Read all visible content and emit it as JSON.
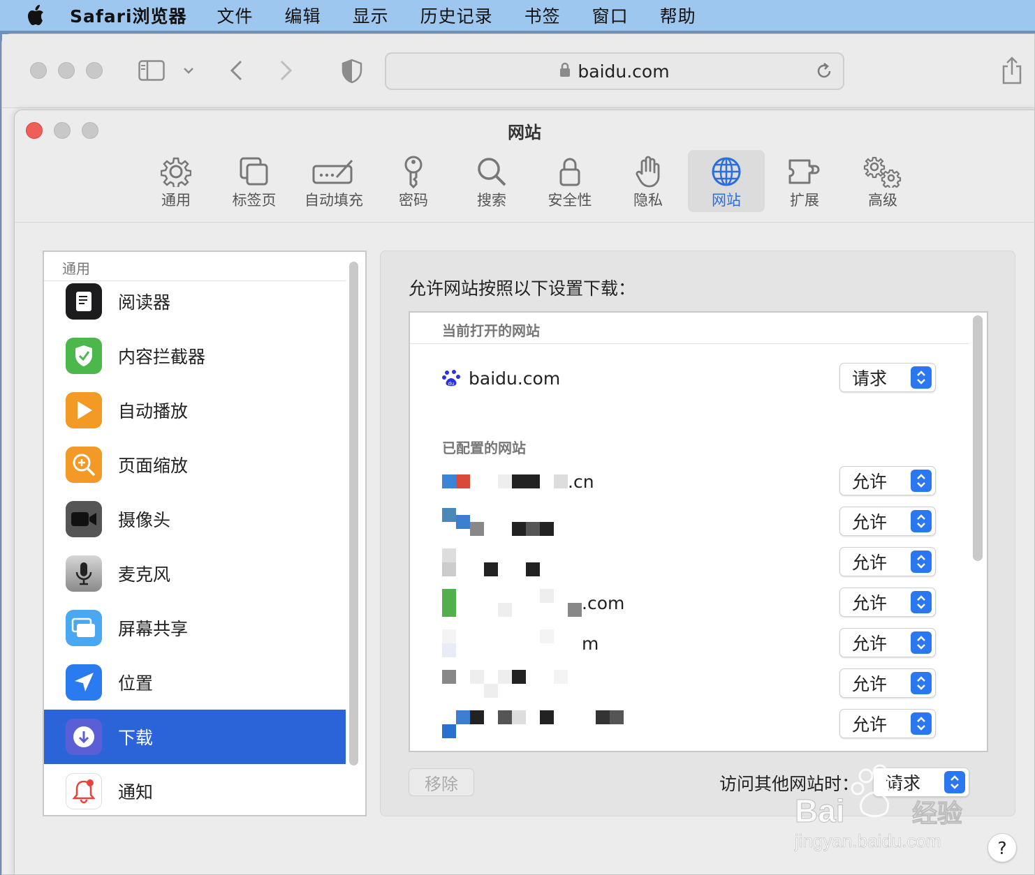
{
  "menubar": {
    "app_name": "Safari浏览器",
    "items": [
      "文件",
      "编辑",
      "显示",
      "历史记录",
      "书签",
      "窗口",
      "帮助"
    ]
  },
  "browser": {
    "url": "baidu.com"
  },
  "prefs": {
    "title": "网站",
    "tabs": [
      {
        "label": "通用",
        "icon": "gear-icon"
      },
      {
        "label": "标签页",
        "icon": "tabs-icon"
      },
      {
        "label": "自动填充",
        "icon": "autofill-icon"
      },
      {
        "label": "密码",
        "icon": "key-icon"
      },
      {
        "label": "搜索",
        "icon": "search-icon"
      },
      {
        "label": "安全性",
        "icon": "lock-icon"
      },
      {
        "label": "隐私",
        "icon": "hand-icon"
      },
      {
        "label": "网站",
        "icon": "globe-icon"
      },
      {
        "label": "扩展",
        "icon": "puzzle-icon"
      },
      {
        "label": "高级",
        "icon": "gears-icon"
      }
    ],
    "active_tab": "网站"
  },
  "sidebar": {
    "header": "通用",
    "items": [
      {
        "label": "阅读器",
        "icon": "reader-icon",
        "color": "#1c1c1e"
      },
      {
        "label": "内容拦截器",
        "icon": "shield-check-icon",
        "color": "#4cb84c"
      },
      {
        "label": "自动播放",
        "icon": "play-icon",
        "color": "#f29a25"
      },
      {
        "label": "页面缩放",
        "icon": "zoom-icon",
        "color": "#f29a25"
      },
      {
        "label": "摄像头",
        "icon": "camera-icon",
        "color": "#555555"
      },
      {
        "label": "麦克风",
        "icon": "microphone-icon",
        "color": "#8a8a8a"
      },
      {
        "label": "屏幕共享",
        "icon": "screen-share-icon",
        "color": "#4aa8f0"
      },
      {
        "label": "位置",
        "icon": "location-icon",
        "color": "#2b7bf0"
      },
      {
        "label": "下载",
        "icon": "download-icon",
        "color": "#5b5fd6"
      },
      {
        "label": "通知",
        "icon": "bell-icon",
        "color": "#ffffff"
      }
    ],
    "selected": "下载"
  },
  "panel": {
    "title": "允许网站按照以下设置下载：",
    "current_header": "当前打开的网站",
    "current_site": {
      "name": "baidu.com",
      "setting": "请求"
    },
    "configured_header": "已配置的网站",
    "configured_sites": [
      {
        "name_visible": ".cn",
        "setting": "允许"
      },
      {
        "name_visible": "",
        "setting": "允许"
      },
      {
        "name_visible": "",
        "setting": "允许"
      },
      {
        "name_visible": ".com",
        "setting": "允许"
      },
      {
        "name_visible": "m",
        "setting": "允许"
      },
      {
        "name_visible": "",
        "setting": "允许"
      },
      {
        "name_visible": "",
        "setting": "允许"
      }
    ],
    "remove_button": "移除",
    "other_sites_label": "访问其他网站时：",
    "other_sites_setting": "请求"
  },
  "help_button": "?",
  "watermark": {
    "brand": "Bai du 经验",
    "url": "jingyan.baidu.com"
  }
}
